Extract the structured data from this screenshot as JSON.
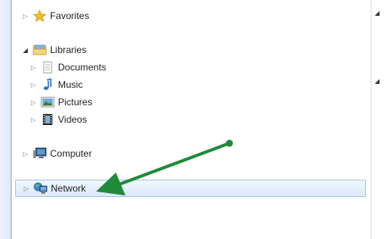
{
  "nav": {
    "favorites": {
      "label": "Favorites",
      "expanded": false
    },
    "libraries": {
      "label": "Libraries",
      "expanded": true,
      "children": [
        {
          "label": "Documents"
        },
        {
          "label": "Music"
        },
        {
          "label": "Pictures"
        },
        {
          "label": "Videos"
        }
      ]
    },
    "computer": {
      "label": "Computer",
      "expanded": false
    },
    "network": {
      "label": "Network",
      "expanded": false,
      "selected": true
    }
  },
  "colors": {
    "annotation_arrow": "#1e8a3a",
    "selection_fill": "#dbe8f8",
    "selection_border": "#a7c2e5"
  },
  "glyphs": {
    "collapsed": "▷",
    "expanded": "◢",
    "caret": "◢"
  }
}
